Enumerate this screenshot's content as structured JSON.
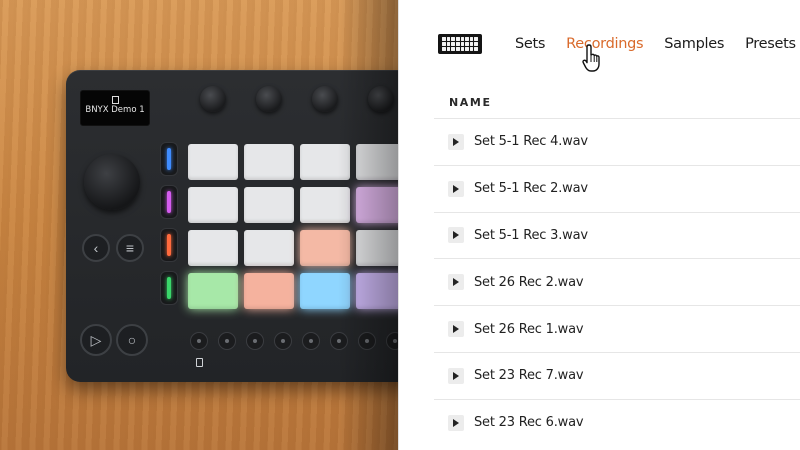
{
  "device": {
    "screen_text": "BNYX Demo 1",
    "pad_colors": [
      [
        "#e6e7e9",
        "#e6e7e9",
        "#e6e7e9",
        "#e6e7e9"
      ],
      [
        "#e6e7e9",
        "#e6e7e9",
        "#e6e7e9",
        "#e2b8ee"
      ],
      [
        "#e6e7e9",
        "#e6e7e9",
        "#f4b9a5",
        "#e6e7e9"
      ],
      [
        "#a7e8a8",
        "#f5b29e",
        "#8fd6ff",
        "#cdb8f5"
      ]
    ],
    "strip_colors": [
      "#3f8cff",
      "#d55cf0",
      "#ff6a3d",
      "#3ad66a"
    ]
  },
  "nav": {
    "items": [
      {
        "label": "Sets",
        "active": false
      },
      {
        "label": "Recordings",
        "active": true
      },
      {
        "label": "Samples",
        "active": false
      },
      {
        "label": "Presets",
        "active": false
      }
    ],
    "accent_color": "#d96a2b"
  },
  "list": {
    "header": "NAME",
    "files": [
      "Set 5-1 Rec 4.wav",
      "Set 5-1 Rec 2.wav",
      "Set 5-1 Rec 3.wav",
      "Set 26 Rec 2.wav",
      "Set 26 Rec 1.wav",
      "Set 23 Rec 7.wav",
      "Set 23 Rec 6.wav"
    ]
  }
}
